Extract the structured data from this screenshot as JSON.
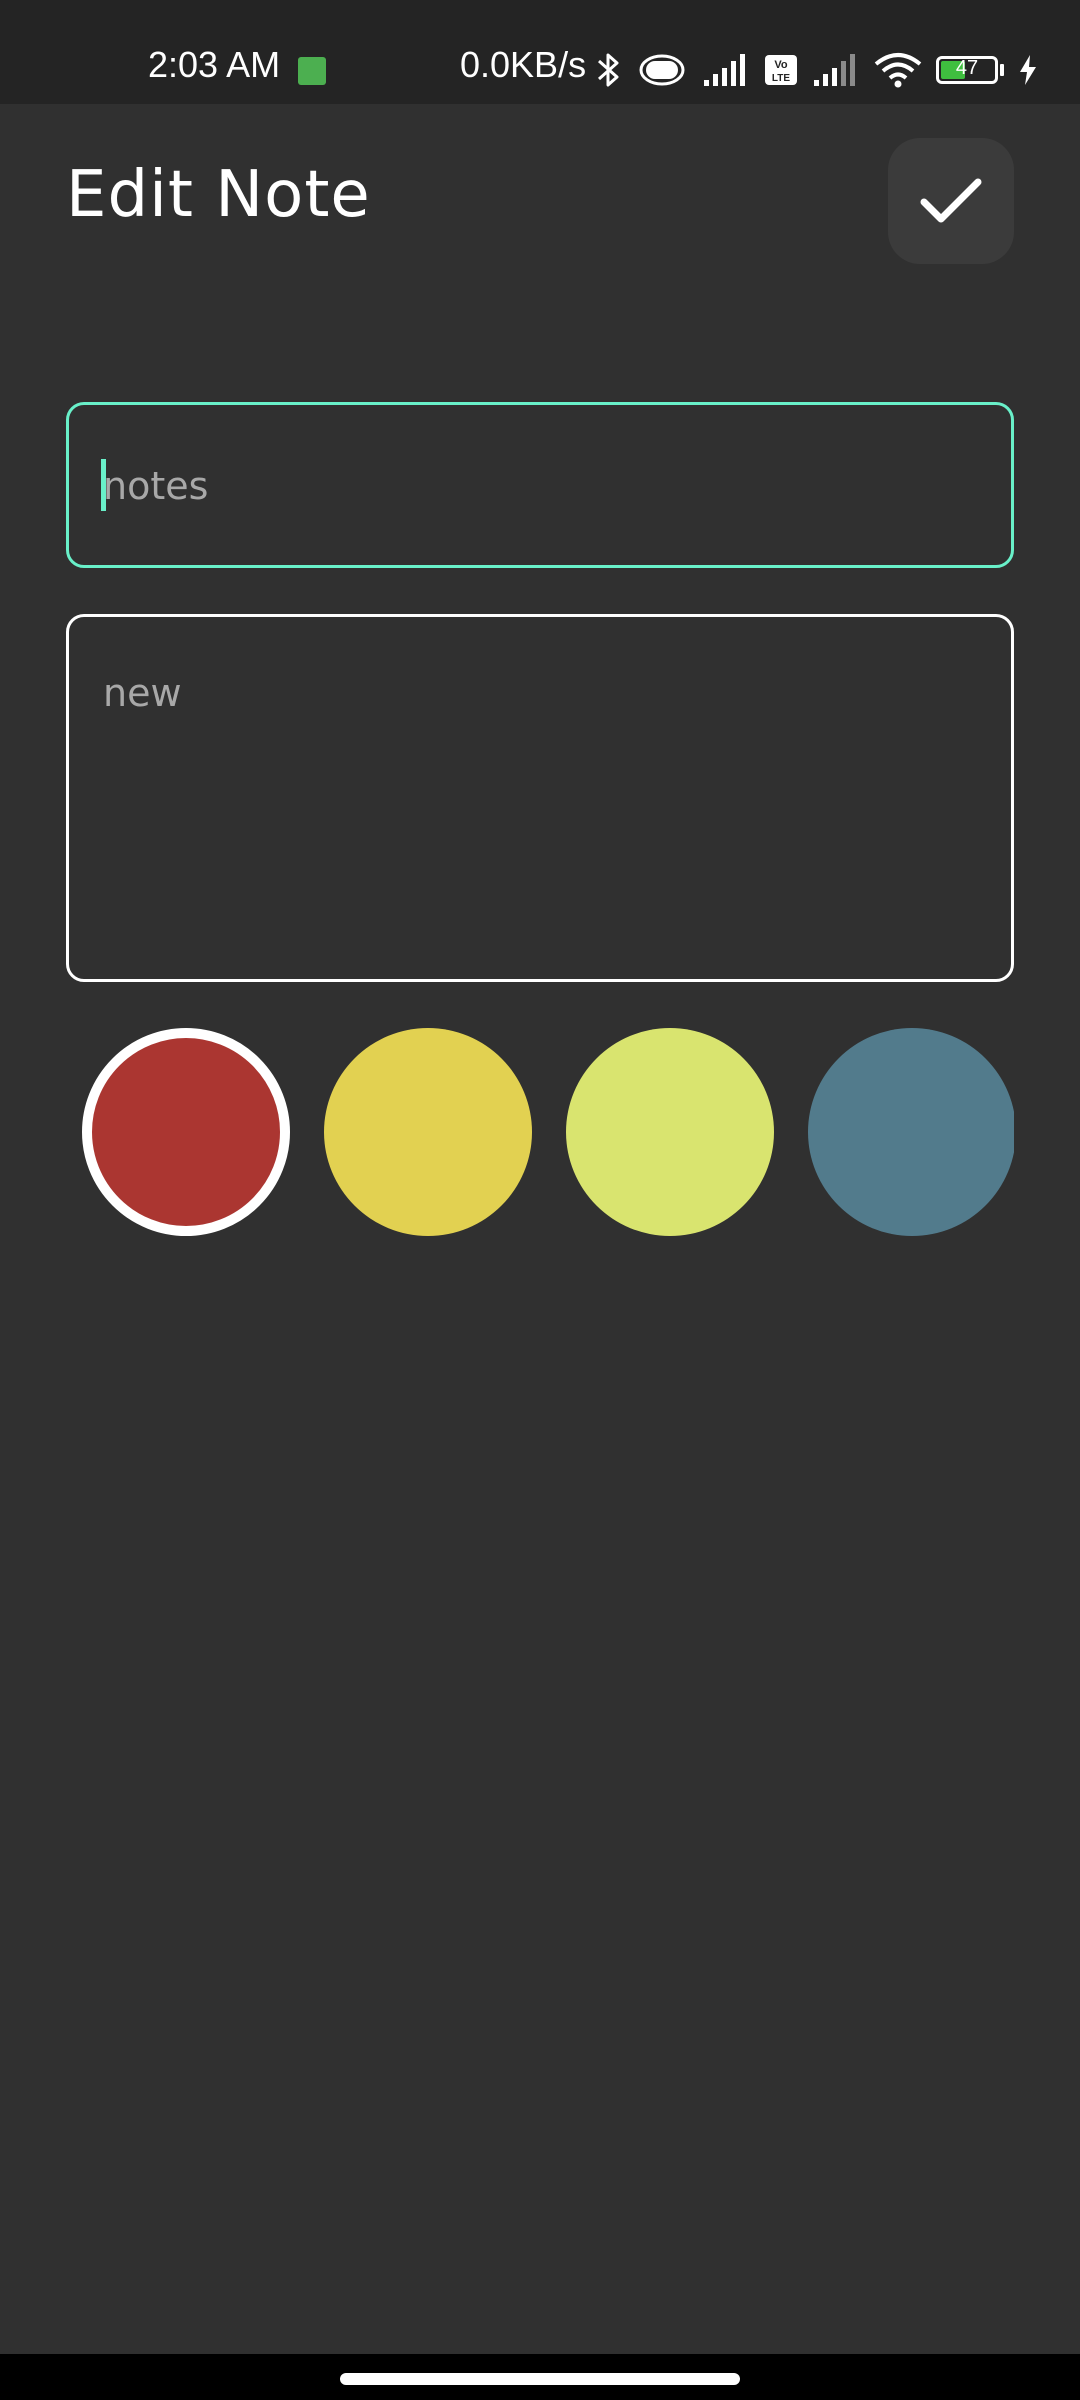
{
  "status_bar": {
    "time": "2:03 AM",
    "network_speed": "0.0KB/s",
    "battery_level": "47",
    "icons": [
      "app-notification-icon",
      "bluetooth-icon",
      "vibrate-icon",
      "signal-icon",
      "volte-icon",
      "signal-2-icon",
      "wifi-icon",
      "battery-icon",
      "charging-icon"
    ]
  },
  "header": {
    "title": "Edit Note",
    "save_icon": "check-icon"
  },
  "form": {
    "title_placeholder": "notes",
    "content_placeholder": "new"
  },
  "colors": {
    "selected_index": 0,
    "swatches": [
      "#ab3631",
      "#e2d151",
      "#d9e46f",
      "#527b8c"
    ]
  },
  "theme": {
    "background": "#303030",
    "accent": "#69f0c9"
  }
}
